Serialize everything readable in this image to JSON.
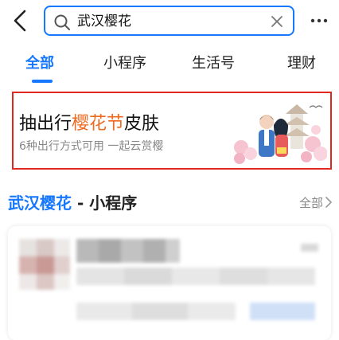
{
  "search": {
    "query": "武汉樱花"
  },
  "tabs": [
    {
      "label": "全部"
    },
    {
      "label": "小程序"
    },
    {
      "label": "生活号"
    },
    {
      "label": "理财"
    }
  ],
  "banner": {
    "title_prefix": "抽出行",
    "title_highlight": "樱花节",
    "title_suffix": "皮肤",
    "subtitle": "6种出行方式可用 一起云赏樱"
  },
  "section": {
    "keyword": "武汉樱花",
    "rest": " - 小程序",
    "see_all": "全部"
  },
  "colors": {
    "accent": "#1677ff",
    "banner_border": "#e0281e",
    "highlight": "#ee6a1f"
  },
  "icons": [
    "back-icon",
    "search-icon",
    "clear-icon",
    "more-icon",
    "chevron-right-icon"
  ]
}
